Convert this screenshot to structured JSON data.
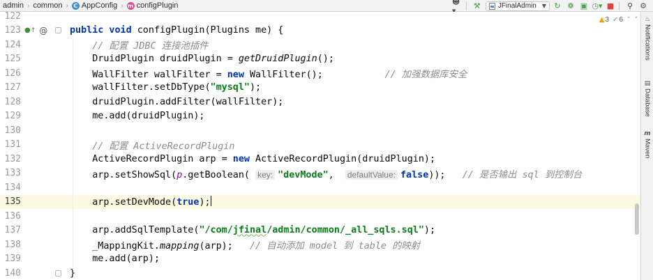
{
  "navbar": {
    "breadcrumbs": [
      {
        "label": "admin",
        "badge": null
      },
      {
        "label": "common",
        "badge": null
      },
      {
        "label": "AppConfig",
        "badge": "C",
        "badge_color": "#3d8fd6"
      },
      {
        "label": "configPlugin",
        "badge": "m",
        "badge_color": "#d64d8f"
      }
    ],
    "run_config": "JFinalAdmin"
  },
  "inspections": {
    "warnings": "3",
    "weak": "6"
  },
  "right_tools": [
    "Notifications",
    "Database",
    "Maven"
  ],
  "colors": {
    "keyword": "#0033b3",
    "string": "#067d17",
    "comment": "#8c8c8c",
    "field": "#871094",
    "current_line": "#fcfae1"
  },
  "editor": {
    "current_line": "135",
    "lines": [
      {
        "num": "122",
        "tokens": []
      },
      {
        "num": "123",
        "tokens": [
          [
            "kw",
            "public void "
          ],
          [
            "",
            "configPlugin(Plugins me) {"
          ]
        ]
      },
      {
        "num": "124",
        "tokens": [
          [
            "cmt",
            "    // 配置 JDBC 连接池插件"
          ]
        ]
      },
      {
        "num": "125",
        "tokens": [
          [
            "",
            "    DruidPlugin druidPlugin = "
          ],
          [
            "mth",
            "getDruidPlugin"
          ],
          [
            "",
            "();"
          ]
        ]
      },
      {
        "num": "126",
        "tokens": [
          [
            "",
            "    WallFilter wallFilter = "
          ],
          [
            "kw",
            "new "
          ],
          [
            "",
            "WallFilter();"
          ],
          [
            "cmt",
            "           // 加强数据库安全"
          ]
        ]
      },
      {
        "num": "127",
        "tokens": [
          [
            "",
            "    wallFilter.setDbType("
          ],
          [
            "str",
            "\"mysql\""
          ],
          [
            "",
            ");"
          ]
        ]
      },
      {
        "num": "128",
        "tokens": [
          [
            "",
            "    druidPlugin.addFilter(wallFilter);"
          ]
        ]
      },
      {
        "num": "129",
        "tokens": [
          [
            "",
            "    me.add(druidPlugin);"
          ]
        ]
      },
      {
        "num": "130",
        "tokens": []
      },
      {
        "num": "131",
        "tokens": [
          [
            "cmt",
            "    // 配置 ActiveRecordPlugin"
          ]
        ]
      },
      {
        "num": "132",
        "tokens": [
          [
            "",
            "    ActiveRecordPlugin arp = "
          ],
          [
            "kw",
            "new "
          ],
          [
            "",
            "ActiveRecordPlugin(druidPlugin);"
          ]
        ]
      },
      {
        "num": "133",
        "tokens": [
          [
            "",
            "    arp.setShowSql("
          ],
          [
            "field",
            "p"
          ],
          [
            "",
            ".getBoolean( "
          ],
          [
            "hint",
            "key:"
          ],
          [
            "str",
            "\"devMode\""
          ],
          [
            "",
            ",  "
          ],
          [
            "hint",
            "defaultValue:"
          ],
          [
            "kw",
            "false"
          ],
          [
            "",
            "));   "
          ],
          [
            "cmt",
            "// 是否输出 sql 到控制台"
          ]
        ]
      },
      {
        "num": "134",
        "tokens": []
      },
      {
        "num": "135",
        "tokens": [
          [
            "",
            "    arp.setDevMode("
          ],
          [
            "kw",
            "true"
          ],
          [
            "",
            ");"
          ],
          [
            "caret",
            ""
          ]
        ]
      },
      {
        "num": "136",
        "tokens": []
      },
      {
        "num": "137",
        "tokens": [
          [
            "",
            "    arp.addSqlTemplate("
          ],
          [
            "str",
            "\"/com/"
          ],
          [
            "strun",
            "jfinal"
          ],
          [
            "str",
            "/admin/common/_all_sqls.sql\""
          ],
          [
            "",
            ");"
          ]
        ]
      },
      {
        "num": "138",
        "tokens": [
          [
            "",
            "    _MappingKit."
          ],
          [
            "mth",
            "mapping"
          ],
          [
            "",
            "(arp);   "
          ],
          [
            "cmt",
            "// 自动添加 model 到 table 的映射"
          ]
        ]
      },
      {
        "num": "139",
        "tokens": [
          [
            "",
            "    me.add(arp);"
          ]
        ]
      },
      {
        "num": "140",
        "tokens": [
          [
            "",
            "}"
          ]
        ]
      }
    ]
  }
}
